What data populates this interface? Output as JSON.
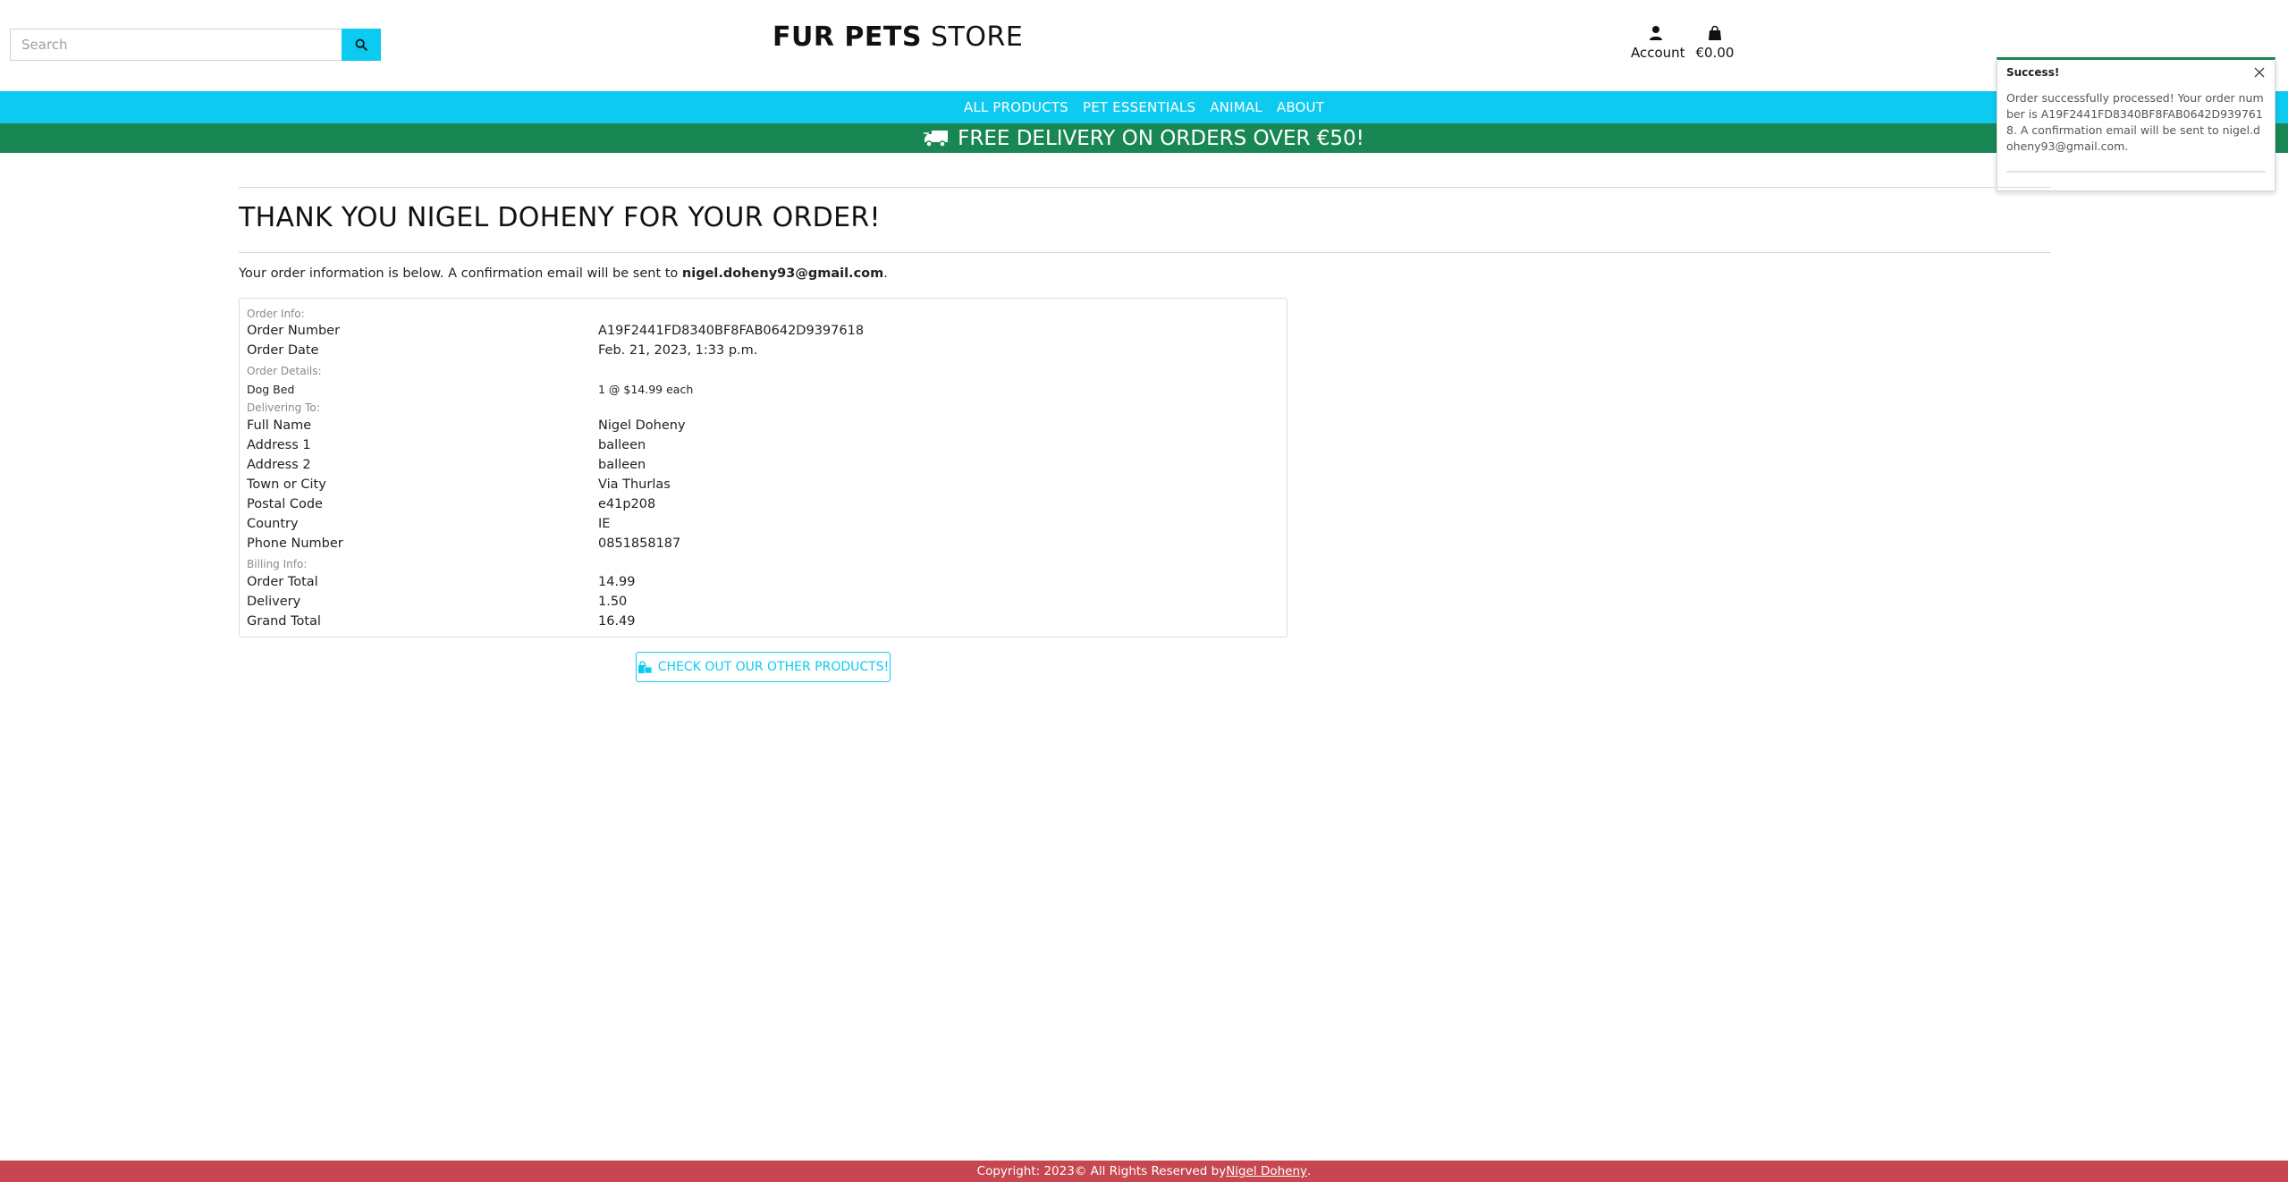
{
  "header": {
    "search_placeholder": "Search",
    "logo_bold": "FUR PETS",
    "logo_rest": " STORE",
    "account_label": "Account",
    "bag_total": "€0.00"
  },
  "nav": {
    "items": [
      "ALL PRODUCTS",
      "PET ESSENTIALS",
      "ANIMAL",
      "ABOUT"
    ]
  },
  "banner": {
    "text": "FREE DELIVERY ON ORDERS OVER €50!"
  },
  "toast": {
    "title": "Success!",
    "message": "Order successfully processed! Your order number is A19F2441FD8340BF8FAB0642D9397618. A confirmation email will be sent to nigel.doheny93@gmail.com."
  },
  "page": {
    "title": "THANK YOU NIGEL DOHENY FOR YOUR ORDER!",
    "intro_text": "Your order information is below. A confirmation email will be sent to ",
    "intro_email": "nigel.doheny93@gmail.com",
    "intro_end": "."
  },
  "order": {
    "order_info_label": "Order Info:",
    "order_number_label": "Order Number",
    "order_number": "A19F2441FD8340BF8FAB0642D9397618",
    "order_date_label": "Order Date",
    "order_date": "Feb. 21, 2023, 1:33 p.m.",
    "order_details_label": "Order Details:",
    "item_name": "Dog Bed",
    "item_qty_price": "1 @ $14.99 each",
    "delivering_to_label": "Delivering To:",
    "full_name_label": "Full Name",
    "full_name": "Nigel Doheny",
    "address1_label": "Address 1",
    "address1": "balleen",
    "address2_label": "Address 2",
    "address2": "balleen",
    "town_label": "Town or City",
    "town": "Via Thurlas",
    "postal_label": "Postal Code",
    "postal": "e41p208",
    "country_label": "Country",
    "country": "IE",
    "phone_label": "Phone Number",
    "phone": "0851858187",
    "billing_label": "Billing Info:",
    "order_total_label": "Order Total",
    "order_total": "14.99",
    "delivery_label": "Delivery",
    "delivery": "1.50",
    "grand_total_label": "Grand Total",
    "grand_total": "16.49"
  },
  "cta": {
    "label": "CHECK OUT OUR OTHER PRODUCTS!"
  },
  "footer": {
    "text": "Copyright: 2023© All Rights Reserved by ",
    "author": "Nigel Doheny",
    "end": "."
  },
  "colors": {
    "nav_bg": "#0dcaf0",
    "banner_bg": "#198754",
    "footer_bg": "#c6474f"
  }
}
